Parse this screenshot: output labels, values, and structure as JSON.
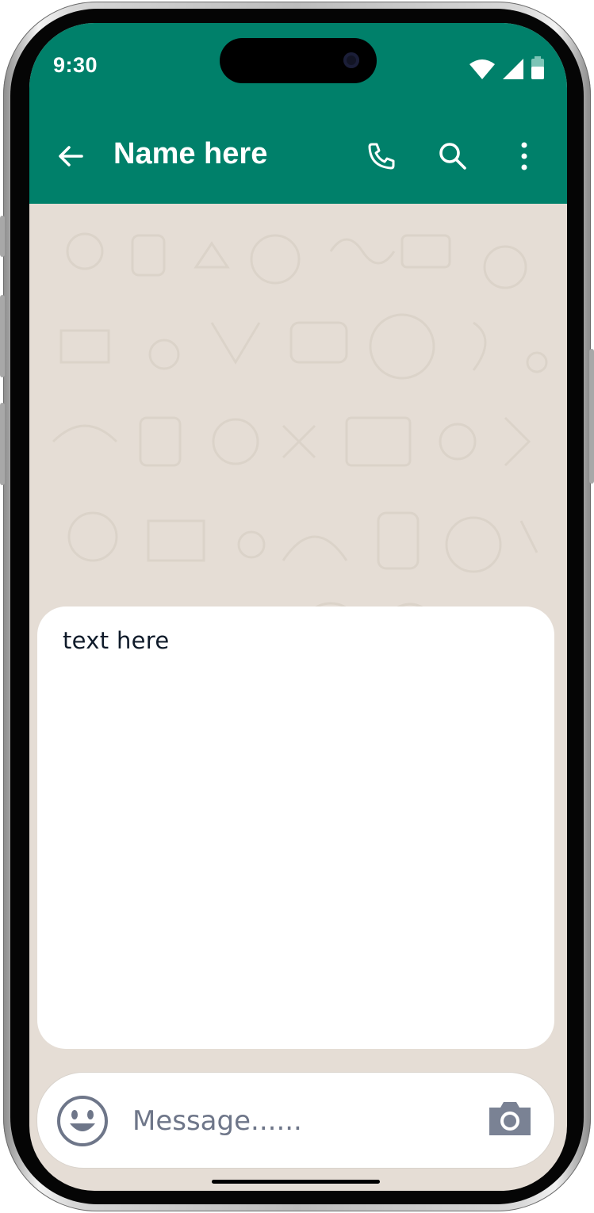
{
  "status_bar": {
    "time": "9:30"
  },
  "header": {
    "contact_name": "Name here",
    "icons": [
      "back-arrow-icon",
      "phone-icon",
      "search-icon",
      "more-vert-icon"
    ],
    "color": "#00806a"
  },
  "chat": {
    "wallpaper_color": "#e5ddd5",
    "message_text": "text here"
  },
  "composer": {
    "placeholder": "Message......",
    "icons": [
      "emoji-icon",
      "camera-icon"
    ]
  }
}
